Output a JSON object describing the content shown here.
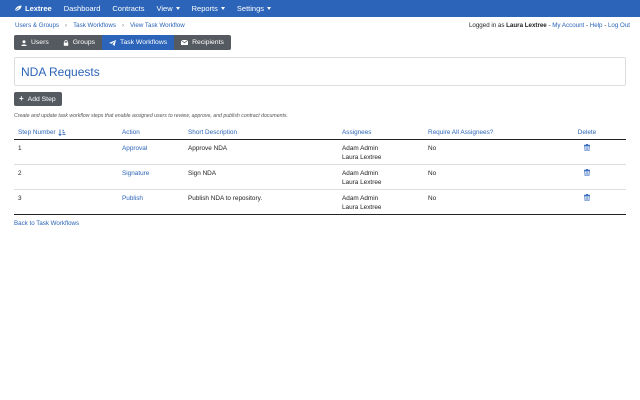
{
  "nav": {
    "brand": "Lextree",
    "items": [
      {
        "label": "Dashboard",
        "dropdown": false
      },
      {
        "label": "Contracts",
        "dropdown": false
      },
      {
        "label": "View",
        "dropdown": true
      },
      {
        "label": "Reports",
        "dropdown": true
      },
      {
        "label": "Settings",
        "dropdown": true
      }
    ]
  },
  "breadcrumb": [
    "Users & Groups",
    "Task Workflows",
    "View Task Workflow"
  ],
  "account": {
    "logged_in_prefix": "Logged in as",
    "user": "Laura Lextree",
    "my_account": "My Account",
    "help": "Help",
    "logout": "Log Out",
    "separator": " - "
  },
  "tabs": [
    {
      "label": "Users",
      "icon": "user-icon",
      "active": false
    },
    {
      "label": "Groups",
      "icon": "lock-icon",
      "active": false
    },
    {
      "label": "Task Workflows",
      "icon": "paper-plane-icon",
      "active": true
    },
    {
      "label": "Recipients",
      "icon": "envelope-icon",
      "active": false
    }
  ],
  "page_title": "NDA Requests",
  "add_step_label": "Add Step",
  "help_text": "Create and update task workflow steps that enable assigned users to review, approve, and publish contract documents.",
  "table": {
    "headers": {
      "step": "Step Number",
      "action": "Action",
      "description": "Short Description",
      "assignees": "Assignees",
      "require_all": "Require All Assignees?",
      "delete": "Delete"
    },
    "rows": [
      {
        "step": "1",
        "action": "Approval",
        "description": "Approve NDA",
        "assignee_1": "Adam Admin",
        "assignee_2": "Laura Lextree",
        "require_all": "No"
      },
      {
        "step": "2",
        "action": "Signature",
        "description": "Sign NDA",
        "assignee_1": "Adam Admin",
        "assignee_2": "Laura Lextree",
        "require_all": "No"
      },
      {
        "step": "3",
        "action": "Publish",
        "description": "Publish NDA to repository.",
        "assignee_1": "Adam Admin",
        "assignee_2": "Laura Lextree",
        "require_all": "No"
      }
    ]
  },
  "back_link": "Back to Task Workflows",
  "colors": {
    "nav_bg": "#2b64b8",
    "link": "#2b64b8",
    "tab_bg": "#555a60"
  }
}
